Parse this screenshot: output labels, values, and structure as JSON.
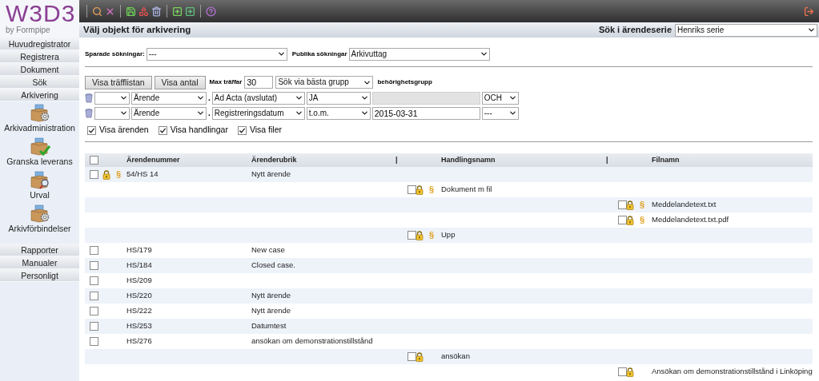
{
  "sidebar": {
    "logo": {
      "title": "W3D3",
      "subtitle": "by Formpipe"
    },
    "items": [
      {
        "kind": "button",
        "label": "Huvudregistrator"
      },
      {
        "kind": "button",
        "label": "Registrera"
      },
      {
        "kind": "button",
        "label": "Dokument"
      },
      {
        "kind": "button",
        "label": "Sök"
      },
      {
        "kind": "button",
        "label": "Arkivering"
      },
      {
        "kind": "icon",
        "label": "Arkivadministration"
      },
      {
        "kind": "icon",
        "label": "Granska leverans"
      },
      {
        "kind": "icon",
        "label": "Urval"
      },
      {
        "kind": "icon",
        "label": "Arkivförbindelser"
      },
      {
        "kind": "spacer"
      },
      {
        "kind": "button",
        "label": "Rapporter"
      },
      {
        "kind": "button",
        "label": "Manualer"
      },
      {
        "kind": "button",
        "label": "Personligt"
      }
    ]
  },
  "page": {
    "title": "Välj objekt för arkivering",
    "series_label": "Sök i ärendeserie",
    "series_value": "Henriks serie"
  },
  "searches": {
    "saved_label": "Sparade sökningar:",
    "saved_value": "---",
    "public_label": "Publika sökningar",
    "public_value": "Arkivuttag"
  },
  "actions": {
    "buttons": [
      "Visa träfflistan",
      "Visa antal"
    ],
    "max_label": "Max träffar",
    "max_value": "30",
    "group_value": "Sök via bästa grupp",
    "group_label": "behörighetsgrupp"
  },
  "criteria": [
    {
      "field": "Ärende",
      "separator": ".",
      "attribute": "Ad Acta (avslutat)",
      "comparator": "JA",
      "value_disabled": true,
      "conjunction": "OCH"
    },
    {
      "field": "Ärende",
      "separator": ".",
      "attribute": "Registreringsdatum",
      "comparator": "t.o.m.",
      "value": "2015-03-31",
      "value_disabled": false,
      "conjunction": "---"
    }
  ],
  "show_options": [
    {
      "label": "Visa ärenden",
      "checked": true
    },
    {
      "label": "Visa handlingar",
      "checked": true
    },
    {
      "label": "Visa filer",
      "checked": true
    }
  ],
  "table": {
    "header_checked": false,
    "columns": [
      "Ärendenummer",
      "Ärenderubrik",
      "|",
      "Handlingsnamn",
      "|",
      "Filnamn"
    ],
    "rows": [
      {
        "kind": "case",
        "checked": false,
        "locked": true,
        "mark": "§",
        "number": "54/HS 14",
        "title": "Nytt ärende"
      },
      {
        "kind": "document",
        "checked": false,
        "locked": true,
        "mark": "§",
        "name": "Dokument m fil"
      },
      {
        "kind": "file",
        "checked": false,
        "locked": true,
        "mark": "§",
        "name": "Meddelandetext.txt"
      },
      {
        "kind": "file",
        "checked": false,
        "locked": true,
        "mark": "§",
        "name": "Meddelandetext.txt.pdf"
      },
      {
        "kind": "document",
        "checked": false,
        "locked": true,
        "mark": "§",
        "name": "Upp"
      },
      {
        "kind": "case",
        "checked": false,
        "locked": false,
        "number": "HS/179",
        "title": "New case"
      },
      {
        "kind": "case",
        "checked": false,
        "locked": false,
        "number": "HS/184",
        "title": "Closed case."
      },
      {
        "kind": "case",
        "checked": false,
        "locked": false,
        "number": "HS/209"
      },
      {
        "kind": "case",
        "checked": false,
        "locked": false,
        "number": "HS/220",
        "title": "Nytt ärende"
      },
      {
        "kind": "case",
        "checked": false,
        "locked": false,
        "number": "HS/222",
        "title": "Nytt ärende"
      },
      {
        "kind": "case",
        "checked": false,
        "locked": false,
        "number": "HS/253",
        "title": "Datumtest"
      },
      {
        "kind": "case",
        "checked": false,
        "locked": false,
        "number": "HS/276",
        "title": "ansökan om demonstrationstillstånd"
      },
      {
        "kind": "document",
        "checked": false,
        "locked": true,
        "name": "ansökan"
      },
      {
        "kind": "file",
        "checked": false,
        "locked": true,
        "name": "Ansökan om demonstrationstillstånd i Linköping"
      }
    ]
  }
}
